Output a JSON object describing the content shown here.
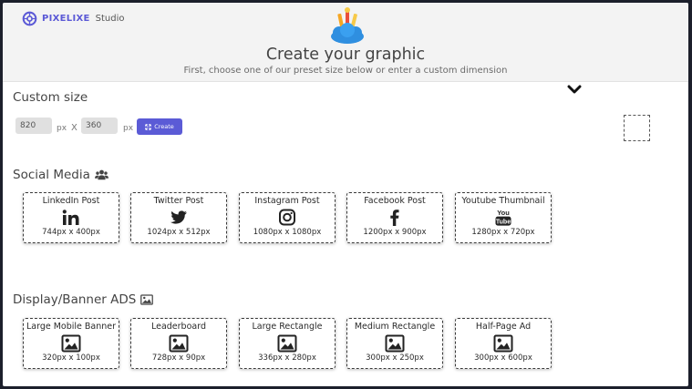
{
  "brand": {
    "name": "PIXELIXE",
    "suffix": "Studio"
  },
  "header": {
    "title": "Create your graphic",
    "subtitle": "First, choose one of our preset size below or enter a custom dimension"
  },
  "custom": {
    "title": "Custom size",
    "width_value": "820",
    "height_value": "360",
    "unit": "px",
    "separator": "X",
    "create_label": "Create"
  },
  "social": {
    "title": "Social Media",
    "cards": [
      {
        "label": "LinkedIn Post",
        "size": "744px x 400px",
        "icon": "linkedin-icon"
      },
      {
        "label": "Twitter Post",
        "size": "1024px x 512px",
        "icon": "twitter-icon"
      },
      {
        "label": "Instagram Post",
        "size": "1080px x 1080px",
        "icon": "instagram-icon"
      },
      {
        "label": "Facebook Post",
        "size": "1200px x 900px",
        "icon": "facebook-icon"
      },
      {
        "label": "Youtube Thumbnail",
        "size": "1280px x 720px",
        "icon": "youtube-icon",
        "icon_text_top": "You",
        "icon_text_bottom": "Tube"
      }
    ]
  },
  "display": {
    "title": "Display/Banner ADS",
    "cards": [
      {
        "label": "Large Mobile Banner",
        "size": "320px x 100px",
        "icon": "image-icon"
      },
      {
        "label": "Leaderboard",
        "size": "728px x 90px",
        "icon": "image-icon"
      },
      {
        "label": "Large Rectangle",
        "size": "336px x 280px",
        "icon": "image-icon"
      },
      {
        "label": "Medium Rectangle",
        "size": "300px x 250px",
        "icon": "image-icon"
      },
      {
        "label": "Half-Page Ad",
        "size": "300px x 600px",
        "icon": "image-icon"
      }
    ]
  },
  "colors": {
    "accent": "#5b5bd6",
    "header_bg": "#f3f3f3",
    "page_bg": "#1c1f2b"
  }
}
